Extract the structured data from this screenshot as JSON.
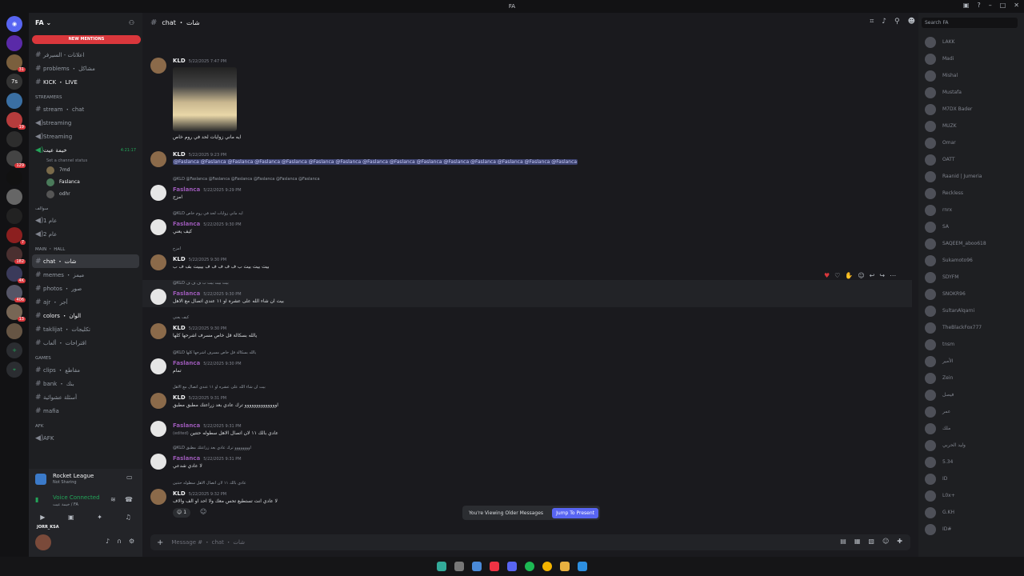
{
  "window": {
    "title": "FA"
  },
  "server": {
    "name": "FA"
  },
  "new_mentions": "NEW MENTIONS",
  "channels": [
    {
      "type": "text",
      "name": "اعلانات - السيرفر"
    },
    {
      "type": "text",
      "name": "problems ・ مشاكل"
    },
    {
      "type": "text",
      "name": "KICK ・ LIVE"
    },
    {
      "type": "category",
      "name": "STREAMERS"
    },
    {
      "type": "text",
      "name": "stream ・ chat"
    },
    {
      "type": "voice",
      "name": "streaming"
    },
    {
      "type": "voice",
      "name": "Streaming"
    },
    {
      "type": "voice",
      "name": "خيمة عيت",
      "time": "4:21:17"
    },
    {
      "type": "sub",
      "name": "Set a channel status"
    },
    {
      "type": "user",
      "name": "7md"
    },
    {
      "type": "user",
      "name": "Faslanca"
    },
    {
      "type": "user",
      "name": "odhr"
    },
    {
      "type": "category",
      "name": "سوالف"
    },
    {
      "type": "voice",
      "name": "عام 1"
    },
    {
      "type": "voice",
      "name": "عام 2"
    },
    {
      "type": "category",
      "name": "MAIN ・ HALL"
    },
    {
      "type": "text",
      "name": "chat ・ شات",
      "active": true
    },
    {
      "type": "text",
      "name": "memes ・ ميمز"
    },
    {
      "type": "text",
      "name": "photos ・ صور"
    },
    {
      "type": "text",
      "name": "ajr ・ أجر"
    },
    {
      "type": "text",
      "name": "colors ・ الوان"
    },
    {
      "type": "text",
      "name": "taklijat ・ تكليجات"
    },
    {
      "type": "text",
      "name": "اقتراحات ・ ألعاب"
    },
    {
      "type": "category",
      "name": "Games"
    },
    {
      "type": "text",
      "name": "clips ・ مقاطع"
    },
    {
      "type": "text",
      "name": "bank ・ بنك"
    },
    {
      "type": "text",
      "name": "أسئلة عشوائية"
    },
    {
      "type": "text",
      "name": "mafia"
    },
    {
      "type": "category",
      "name": "AFK"
    },
    {
      "type": "voice",
      "name": "AFK"
    }
  ],
  "activity": {
    "game": "Rocket League",
    "status": "Not Sharing"
  },
  "voice": {
    "status": "Voice Connected",
    "channel": "خيمة عيت / FA"
  },
  "user": {
    "name": "JORR_KSA"
  },
  "channel_header": {
    "name": "chat ・ شات"
  },
  "messages": [
    {
      "author": "KLD",
      "time": "5/22/2025 7:47 PM",
      "text": "ايه ماني زوايات لحد في روم خاص",
      "image": true
    },
    {
      "author": "KLD",
      "time": "5/22/2025 9:23 PM",
      "text": "@Faslanca @Faslanca @Faslanca @Faslanca @Faslanca @Faslanca @Faslanca @Faslanca @Faslanca @Faslanca @Faslanca @Faslanca @Faslanca @Faslanca @Faslanca"
    },
    {
      "author": "Faslanca",
      "time": "5/22/2025 9:29 PM",
      "text": "امزح",
      "reply": "@KLD @Faslanca @Faslanca @Faslanca @Faslanca @Faslanca @Faslanca"
    },
    {
      "author": "Faslanca",
      "time": "5/22/2025 9:30 PM",
      "text": "كيف يعني",
      "reply": "@KLD ايه ماني زوايات لحد في روم خاص"
    },
    {
      "author": "KLD",
      "time": "5/22/2025 9:30 PM",
      "text": "بيت بيت بيت ب ف ف ف ف ف بيبيت بف ف ب",
      "reply": "امزح"
    },
    {
      "author": "Faslanca",
      "time": "5/22/2025 9:30 PM",
      "text": "بيت ان شاء الله على عشره او ١١ عندي اتصال مع الاهل",
      "reply": "@KLD بيت بيت بيت ب ف ف ف"
    },
    {
      "author": "KLD",
      "time": "5/22/2025 9:30 PM",
      "text": "يالله بسكالة قل خاص مسرف اشرحها كلها",
      "reply": "كيف يعني"
    },
    {
      "author": "Faslanca",
      "time": "5/22/2025 9:30 PM",
      "text": "تمام",
      "reply": "@KLD يالله بسكالة قل خاص مسرف اشرحها كلها"
    },
    {
      "author": "KLD",
      "time": "5/22/2025 9:31 PM",
      "text": "اوووووووووووووو ترك عادي بعد زراعتك مطبق مطبق",
      "reply": "بيت ان شاء الله على عشره او ١١ عندي اتصال مع الاهل"
    },
    {
      "author": "Faslanca",
      "time": "5/22/2025 9:31 PM",
      "text": "عادي بالك ١١ لان اتصال الاهل سطوله حتتين",
      "edited": "(edited)"
    },
    {
      "author": "Faslanca",
      "time": "5/22/2025 9:31 PM",
      "text": "لا عادي شدعي",
      "reply": "@KLD اوووووووو ترك عادي بعد زراعتك مطبق"
    },
    {
      "author": "KLD",
      "time": "5/22/2025 9:32 PM",
      "text": "لا عادي انت تستطيع تحس معك ولا احد او الف والاف",
      "reply": "عادي بالك ١١ لان اتصال الاهل سطوله حتتين",
      "reaction": "1"
    }
  ],
  "older_banner": {
    "text": "You're Viewing Older Messages",
    "button": "Jump To Present"
  },
  "composer": {
    "placeholder": "Message # ・ chat ・ شات"
  },
  "search": {
    "placeholder": "Search FA"
  },
  "members": [
    "LAKK",
    "Madi",
    "Mishal",
    "Mustafa",
    "M7DX Bader",
    "MUZK",
    "Omar",
    "OATT",
    "Raanid | Jumeria",
    "Reckless",
    "rnrx",
    "SA",
    "SAQEEM_aboo618",
    "Sukamoto96",
    "SDYFM",
    "SNOKR96",
    "SultanAlqarni",
    "TheBlackFox777",
    "tnsm",
    "الأمير",
    "Zein",
    "فيصل",
    "عمر",
    "ملك",
    "وليد الحربي",
    "5.34",
    "ID",
    "L0x+",
    "G.KH",
    "ID#"
  ]
}
